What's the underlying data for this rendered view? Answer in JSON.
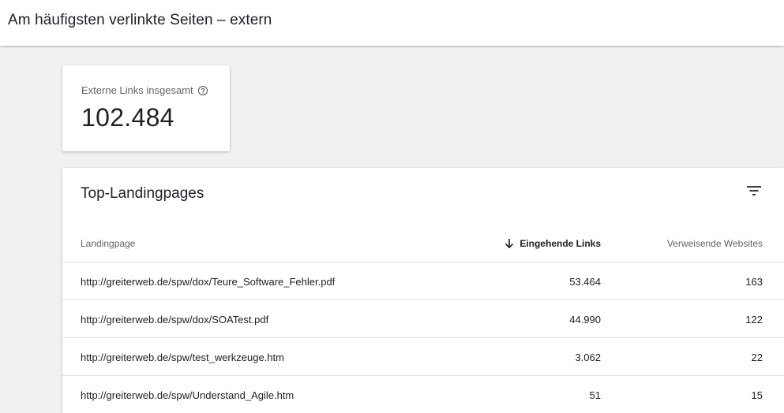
{
  "header": {
    "title": "Am häufigsten verlinkte Seiten – extern"
  },
  "stat": {
    "label": "Externe Links insgesamt",
    "value": "102.484",
    "help_icon": "help-circle-icon"
  },
  "table": {
    "title": "Top-Landingpages",
    "filter_icon": "filter-icon",
    "columns": {
      "landingpage": "Landingpage",
      "incoming_links": "Eingehende Links",
      "referring_sites": "Verweisende Websites"
    },
    "sort_icon": "arrow-down-icon",
    "rows": [
      {
        "url": "http://greiterweb.de/spw/dox/Teure_Software_Fehler.pdf",
        "links": "53.464",
        "sites": "163"
      },
      {
        "url": "http://greiterweb.de/spw/dox/SOATest.pdf",
        "links": "44.990",
        "sites": "122"
      },
      {
        "url": "http://greiterweb.de/spw/test_werkzeuge.htm",
        "links": "3.062",
        "sites": "22"
      },
      {
        "url": "http://greiterweb.de/spw/Understand_Agile.htm",
        "links": "51",
        "sites": "15"
      }
    ]
  }
}
